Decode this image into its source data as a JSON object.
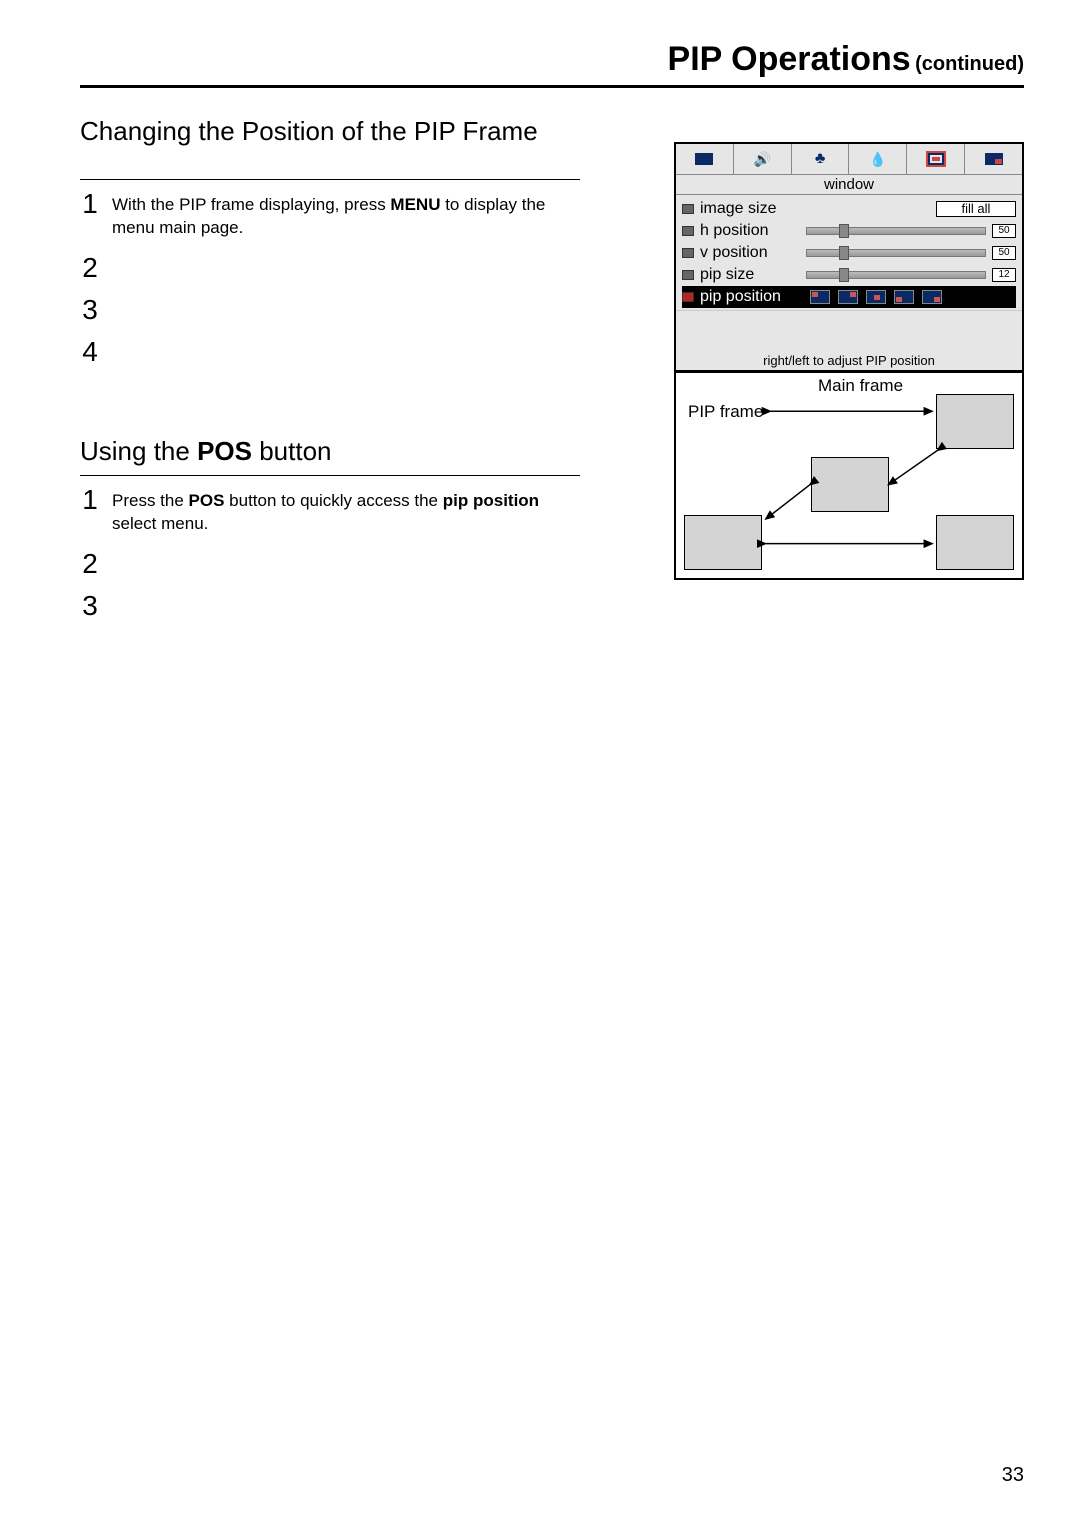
{
  "header": {
    "title": "PIP Operations",
    "continued": "(continued)"
  },
  "section1": {
    "title": "Changing the Position of the PIP Frame",
    "steps": [
      {
        "n": "1",
        "pre": "With the PIP frame displaying, press ",
        "bold": "MENU",
        "post": " to display the menu main page."
      },
      {
        "n": "2",
        "pre": "",
        "bold": "",
        "post": ""
      },
      {
        "n": "3",
        "pre": "",
        "bold": "",
        "post": ""
      },
      {
        "n": "4",
        "pre": "",
        "bold": "",
        "post": ""
      }
    ]
  },
  "section2": {
    "title_pre": "Using the ",
    "title_bold": "POS",
    "title_post": " button",
    "steps": [
      {
        "n": "1",
        "pre": "Press the  ",
        "b1": "POS",
        "mid": " button to quickly access the ",
        "b2": "pip position",
        "post": " select menu."
      },
      {
        "n": "2",
        "pre": "",
        "b1": "",
        "mid": "",
        "b2": "",
        "post": ""
      },
      {
        "n": "3",
        "pre": "",
        "b1": "",
        "mid": "",
        "b2": "",
        "post": ""
      }
    ]
  },
  "osd": {
    "tab_label": "window",
    "rows": {
      "image_size": {
        "label": "image size",
        "value": "fill all"
      },
      "h_position": {
        "label": "h position",
        "value": "50"
      },
      "v_position": {
        "label": "v position",
        "value": "50"
      },
      "pip_size": {
        "label": "pip size",
        "value": "12"
      },
      "pip_position": {
        "label": "pip position"
      }
    },
    "hint": "right/left to adjust PIP position"
  },
  "diagram": {
    "main_label": "Main frame",
    "pip_label": "PIP frame"
  },
  "page_number": "33"
}
